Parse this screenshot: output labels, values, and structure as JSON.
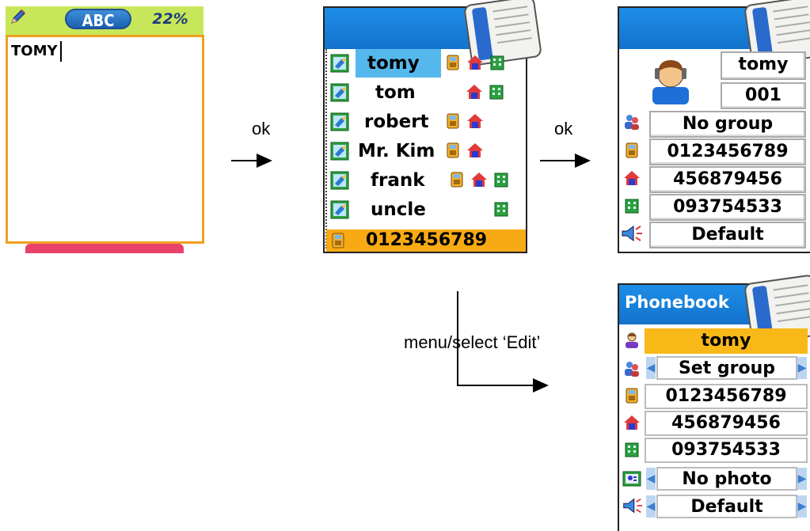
{
  "screen1": {
    "mode": "ABC",
    "battery": "22%",
    "input_value": "TOMY"
  },
  "arrow1_label": "ok",
  "arrow2_label": "ok",
  "arrow3_label": "menu/select ‘Edit’",
  "screen2": {
    "contacts": [
      {
        "name": "tomy",
        "icons": [
          "mobile",
          "home",
          "office"
        ],
        "selected": true
      },
      {
        "name": "tom",
        "icons": [
          "home",
          "office"
        ]
      },
      {
        "name": "robert",
        "icons": [
          "mobile",
          "home"
        ]
      },
      {
        "name": "Mr. Kim",
        "icons": [
          "mobile",
          "home"
        ]
      },
      {
        "name": "frank",
        "icons": [
          "mobile",
          "home",
          "office"
        ]
      },
      {
        "name": "uncle",
        "icons": [
          "office"
        ]
      }
    ],
    "selected_number": "0123456789"
  },
  "screen3": {
    "name": "tomy",
    "index": "001",
    "group": "No group",
    "mobile": "0123456789",
    "home": "456879456",
    "office": "093754533",
    "ringtone": "Default"
  },
  "screen4": {
    "title": "Phonebook",
    "name": "tomy",
    "group": "Set group",
    "mobile": "0123456789",
    "home": "456879456",
    "office": "093754533",
    "photo": "No photo",
    "ringtone": "Default"
  },
  "colors": {
    "header_blue": "#1a84e0",
    "selection_blue": "#55b8ec",
    "highlight_orange": "#f8aa14",
    "status_green": "#c8e65a",
    "edit_border": "#f0a020"
  }
}
